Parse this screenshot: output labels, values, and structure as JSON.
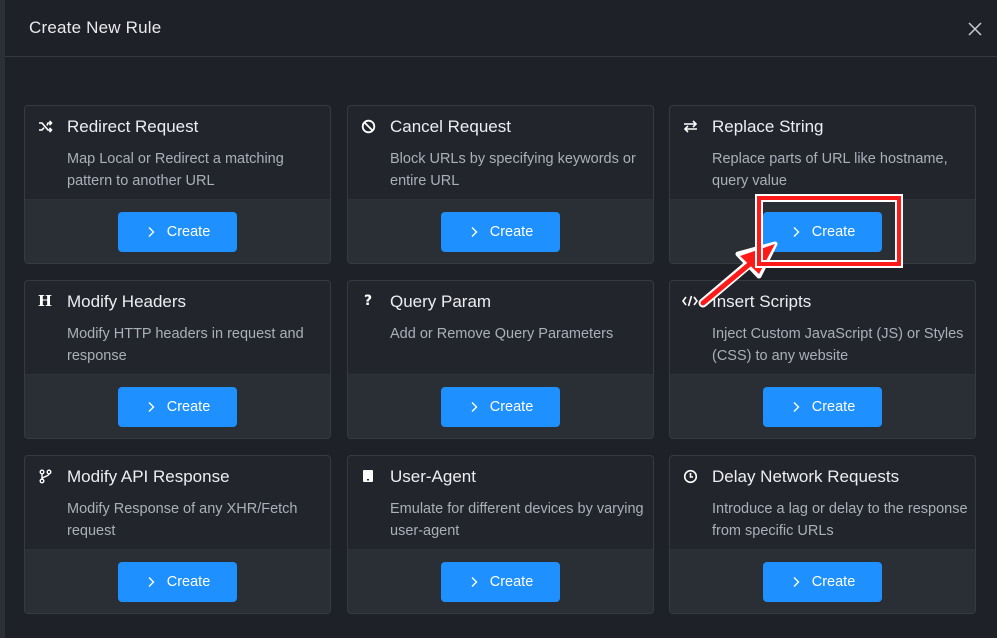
{
  "modal": {
    "title": "Create New Rule",
    "close_label": "X"
  },
  "cards": [
    {
      "id": "redirect",
      "icon": "shuffle-icon",
      "title": "Redirect Request",
      "desc": "Map Local or Redirect a matching pattern to another URL",
      "button": "Create"
    },
    {
      "id": "cancel",
      "icon": "block-icon",
      "title": "Cancel Request",
      "desc": "Block URLs by specifying keywords or entire URL",
      "button": "Create"
    },
    {
      "id": "replace",
      "icon": "swap-arrows-icon",
      "title": "Replace String",
      "desc": "Replace parts of URL like hostname, query value",
      "button": "Create"
    },
    {
      "id": "headers",
      "icon": "header-h-icon",
      "title": "Modify Headers",
      "desc": "Modify HTTP headers in request and response",
      "button": "Create"
    },
    {
      "id": "query",
      "icon": "question-icon",
      "title": "Query Param",
      "desc": "Add or Remove Query Parameters",
      "button": "Create"
    },
    {
      "id": "scripts",
      "icon": "code-icon",
      "title": "Insert Scripts",
      "desc": "Inject Custom JavaScript (JS) or Styles (CSS) to any website",
      "button": "Create"
    },
    {
      "id": "api",
      "icon": "branch-icon",
      "title": "Modify API Response",
      "desc": "Modify Response of any XHR/Fetch request",
      "button": "Create"
    },
    {
      "id": "useragent",
      "icon": "device-icon",
      "title": "User-Agent",
      "desc": "Emulate for different devices by varying user-agent",
      "button": "Create"
    },
    {
      "id": "delay",
      "icon": "clock-icon",
      "title": "Delay Network Requests",
      "desc": "Introduce a lag or delay to the response from specific URLs",
      "button": "Create"
    }
  ],
  "colors": {
    "accent": "#1e90ff",
    "highlight": "#ff1a1a"
  }
}
